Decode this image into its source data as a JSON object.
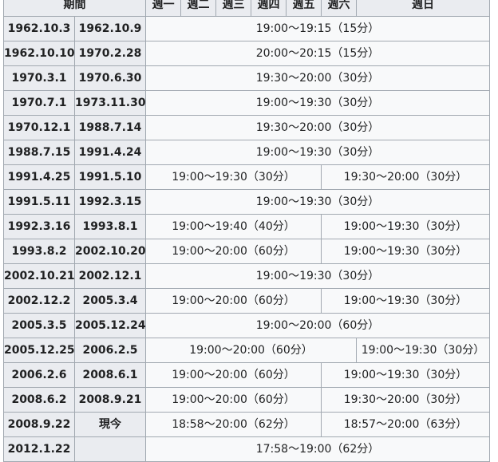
{
  "header": {
    "period": "期間",
    "days": [
      "週一",
      "週二",
      "週三",
      "週四",
      "週五",
      "週六",
      "週日"
    ]
  },
  "rows": [
    {
      "start": "1962.10.3",
      "end": "1962.10.9",
      "slots": [
        {
          "text": "19:00～19:15（15分）",
          "span": 7
        }
      ]
    },
    {
      "start": "1962.10.10",
      "end": "1970.2.28",
      "slots": [
        {
          "text": "20:00～20:15（15分）",
          "span": 7
        }
      ]
    },
    {
      "start": "1970.3.1",
      "end": "1970.6.30",
      "slots": [
        {
          "text": "19:30～20:00（30分）",
          "span": 7
        }
      ]
    },
    {
      "start": "1970.7.1",
      "end": "1973.11.30",
      "slots": [
        {
          "text": "19:00～19:30（30分）",
          "span": 7
        }
      ]
    },
    {
      "start": "1970.12.1",
      "end": "1988.7.14",
      "slots": [
        {
          "text": "19:30～20:00（30分）",
          "span": 7
        }
      ]
    },
    {
      "start": "1988.7.15",
      "end": "1991.4.24",
      "slots": [
        {
          "text": "19:00～19:30（30分）",
          "span": 7
        }
      ]
    },
    {
      "start": "1991.4.25",
      "end": "1991.5.10",
      "slots": [
        {
          "text": "19:00～19:30（30分）",
          "span": 5
        },
        {
          "text": "19:30～20:00（30分）",
          "span": 2
        }
      ]
    },
    {
      "start": "1991.5.11",
      "end": "1992.3.15",
      "slots": [
        {
          "text": "19:00～19:30（30分）",
          "span": 7
        }
      ]
    },
    {
      "start": "1992.3.16",
      "end": "1993.8.1",
      "slots": [
        {
          "text": "19:00～19:40（40分）",
          "span": 5
        },
        {
          "text": "19:00～19:30（30分）",
          "span": 2
        }
      ]
    },
    {
      "start": "1993.8.2",
      "end": "2002.10.20",
      "slots": [
        {
          "text": "19:00～20:00（60分）",
          "span": 5
        },
        {
          "text": "19:00～19:30（30分）",
          "span": 2
        }
      ]
    },
    {
      "start": "2002.10.21",
      "end": "2002.12.1",
      "slots": [
        {
          "text": "19:00～19:30（30分）",
          "span": 7
        }
      ]
    },
    {
      "start": "2002.12.2",
      "end": "2005.3.4",
      "slots": [
        {
          "text": "19:00～20:00（60分）",
          "span": 5
        },
        {
          "text": "19:00～19:30（30分）",
          "span": 2
        }
      ]
    },
    {
      "start": "2005.3.5",
      "end": "2005.12.24",
      "slots": [
        {
          "text": "19:00～20:00（60分）",
          "span": 7
        }
      ]
    },
    {
      "start": "2005.12.25",
      "end": "2006.2.5",
      "slots": [
        {
          "text": "19:00～20:00（60分）",
          "span": 6
        },
        {
          "text": "19:00～19:30（30分）",
          "span": 1
        }
      ]
    },
    {
      "start": "2006.2.6",
      "end": "2008.6.1",
      "slots": [
        {
          "text": "19:00～20:00（60分）",
          "span": 5
        },
        {
          "text": "19:00～19:30（30分）",
          "span": 2
        }
      ]
    },
    {
      "start": "2008.6.2",
      "end": "2008.9.21",
      "slots": [
        {
          "text": "19:00～20:00（60分）",
          "span": 5
        },
        {
          "text": "19:30～20:00（30分）",
          "span": 2
        }
      ]
    },
    {
      "start": "2008.9.22",
      "end": "現今",
      "slots": [
        {
          "text": "18:58～20:00（62分）",
          "span": 5
        },
        {
          "text": "18:57～20:00（63分）",
          "span": 2
        }
      ]
    },
    {
      "start": "2012.1.22",
      "end": "",
      "slots": [
        {
          "text": "17:58～19:00（62分）",
          "span": 7
        }
      ]
    }
  ]
}
